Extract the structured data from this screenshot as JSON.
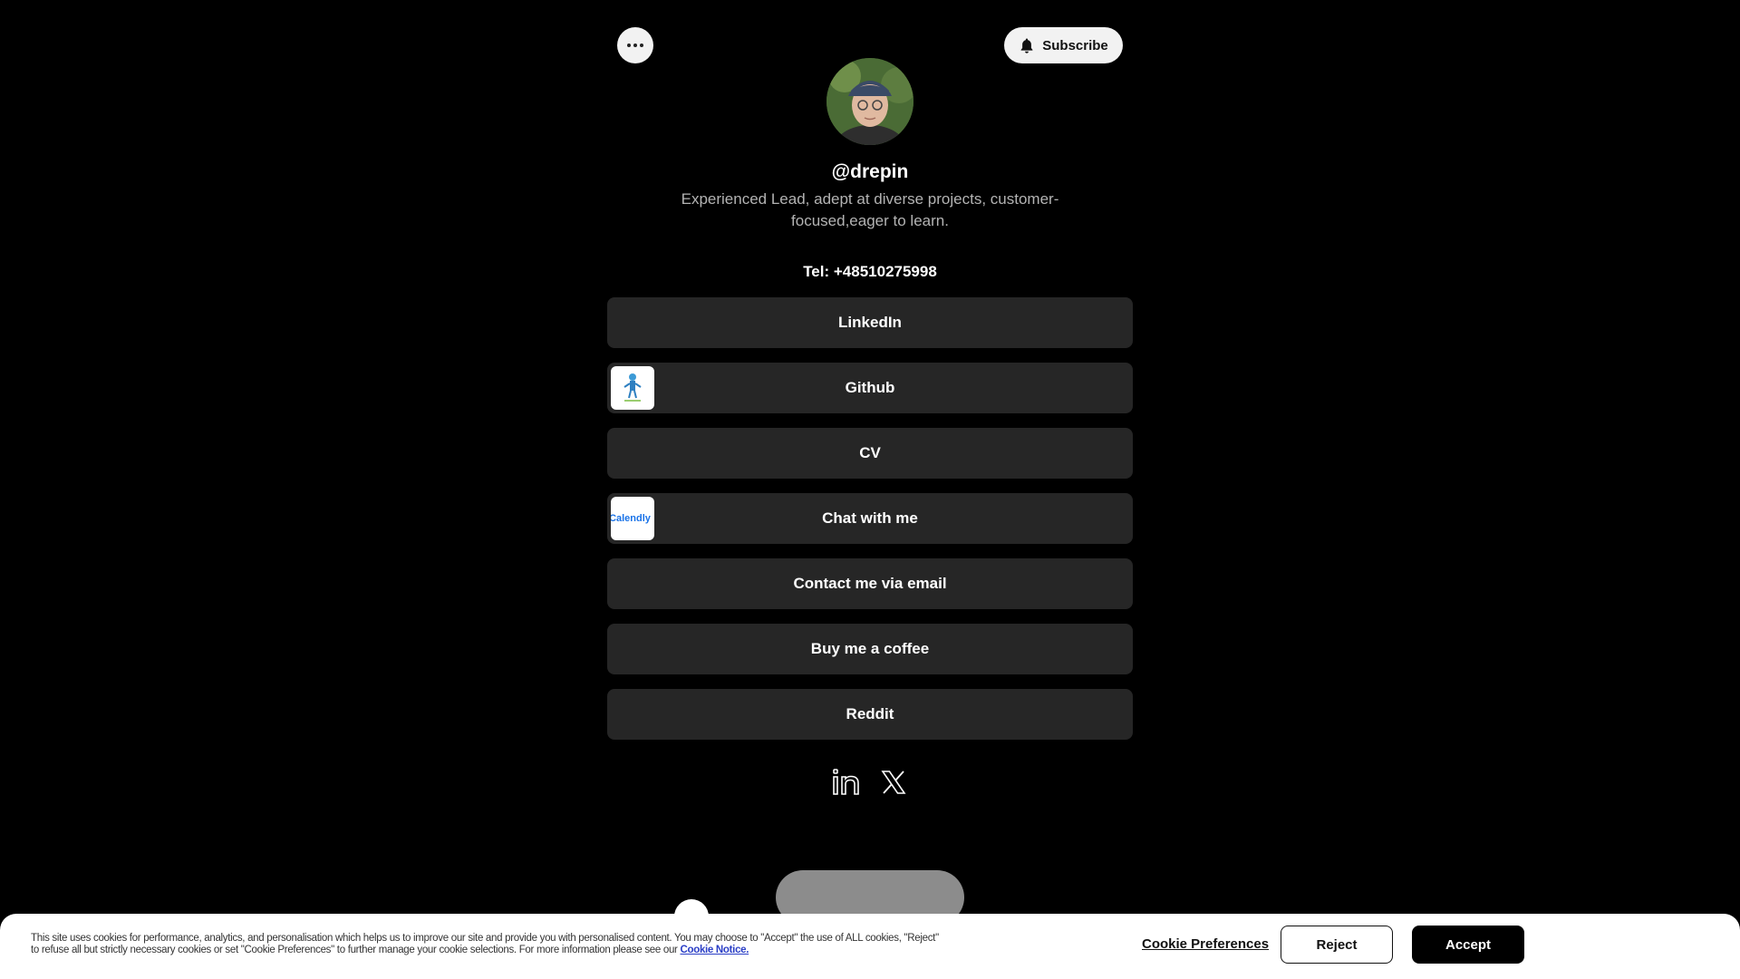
{
  "header": {
    "more_icon": "ellipsis-icon",
    "subscribe_label": "Subscribe",
    "subscribe_icon": "bell-icon"
  },
  "profile": {
    "username": "@drepin",
    "bio": "Experienced Lead, adept at diverse projects, customer-focused,eager to learn.",
    "tel": "Tel: +48510275998"
  },
  "links": [
    {
      "label": "LinkedIn"
    },
    {
      "label": "Github",
      "thumbnail": "github-figure-thumbnail"
    },
    {
      "label": "CV"
    },
    {
      "label": "Chat with me",
      "thumbnail": "calendly-thumbnail",
      "thumbnail_text": "Calendly"
    },
    {
      "label": "Contact me via email"
    },
    {
      "label": "Buy me a coffee"
    },
    {
      "label": "Reddit"
    }
  ],
  "socials": [
    {
      "icon": "linkedin-icon"
    },
    {
      "icon": "x-twitter-icon"
    }
  ],
  "cookie_banner": {
    "text": "This site uses cookies for performance, analytics, and personalisation which helps us to improve our site and provide you with personalised content. You may choose to \"Accept\" the use of ALL cookies, \"Reject\" to refuse all but strictly necessary cookies or set \"Cookie Preferences\" to further manage your cookie selections. For more information please see our",
    "notice_link": "Cookie Notice.",
    "preferences_label": "Cookie Preferences",
    "reject_label": "Reject",
    "accept_label": "Accept"
  },
  "colors": {
    "background": "#000000",
    "link_button": "#262626",
    "banner": "#ffffff",
    "accept": "#000000",
    "notice_link": "#2b3fc6"
  }
}
